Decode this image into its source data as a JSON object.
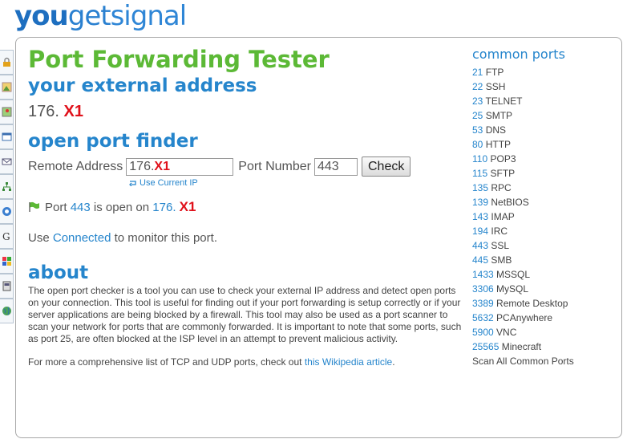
{
  "logo": {
    "part1": "you",
    "part2": "get",
    "part3": "signal"
  },
  "sidebar": {
    "icons": [
      "lock-icon",
      "image-icon",
      "map-icon",
      "window-icon",
      "mail-icon",
      "network-icon",
      "help-icon",
      "google-icon",
      "windows-icon",
      "router-icon",
      "globe-icon"
    ]
  },
  "page": {
    "title": "Port Forwarding Tester",
    "external_heading": "your external address",
    "external_ip": "176.",
    "external_ip_mask": "X1",
    "finder_heading": "open port finder",
    "remote_label": "Remote Address",
    "remote_value": "176.",
    "remote_mask": "X1",
    "port_label": "Port Number",
    "port_value": "443",
    "check_label": "Check",
    "use_current_ip": "Use Current IP",
    "status_port_word": "Port",
    "status_port": "443",
    "status_middle": "is open on",
    "status_ip": "176.",
    "status_ip_mask": "X1",
    "monitor_pre": "Use",
    "monitor_link": "Connected",
    "monitor_post": "to monitor this port.",
    "about_heading": "about",
    "about_text": "The open port checker is a tool you can use to check your external IP address and detect open ports on your connection. This tool is useful for finding out if your port forwarding is setup correctly or if your server applications are being blocked by a firewall. This tool may also be used as a port scanner to scan your network for ports that are commonly forwarded. It is important to note that some ports, such as port 25, are often blocked at the ISP level in an attempt to prevent malicious activity.",
    "more_pre": "For more a comprehensive list of TCP and UDP ports, check out",
    "more_link": "this Wikipedia article",
    "more_post": "."
  },
  "common_ports": {
    "heading": "common ports",
    "items": [
      {
        "port": "21",
        "name": "FTP"
      },
      {
        "port": "22",
        "name": "SSH"
      },
      {
        "port": "23",
        "name": "TELNET"
      },
      {
        "port": "25",
        "name": "SMTP"
      },
      {
        "port": "53",
        "name": "DNS"
      },
      {
        "port": "80",
        "name": "HTTP"
      },
      {
        "port": "110",
        "name": "POP3"
      },
      {
        "port": "115",
        "name": "SFTP"
      },
      {
        "port": "135",
        "name": "RPC"
      },
      {
        "port": "139",
        "name": "NetBIOS"
      },
      {
        "port": "143",
        "name": "IMAP"
      },
      {
        "port": "194",
        "name": "IRC"
      },
      {
        "port": "443",
        "name": "SSL"
      },
      {
        "port": "445",
        "name": "SMB"
      },
      {
        "port": "1433",
        "name": "MSSQL"
      },
      {
        "port": "3306",
        "name": "MySQL"
      },
      {
        "port": "3389",
        "name": "Remote Desktop"
      },
      {
        "port": "5632",
        "name": "PCAnywhere"
      },
      {
        "port": "5900",
        "name": "VNC"
      },
      {
        "port": "25565",
        "name": "Minecraft"
      }
    ],
    "scan_all": "Scan All Common Ports"
  },
  "colors": {
    "accent_blue": "#2585cc",
    "title_green": "#5cb936",
    "mask_red": "#e0101a"
  }
}
